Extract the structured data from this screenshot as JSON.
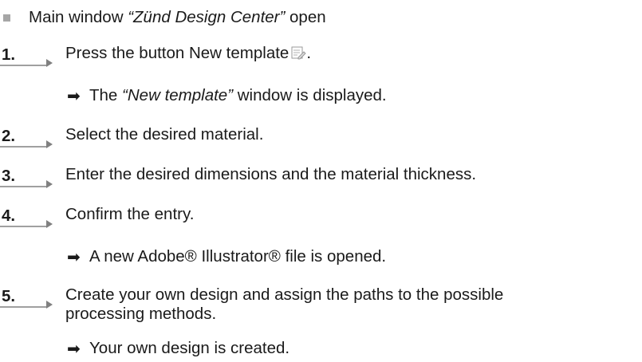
{
  "prerequisite": {
    "text_before": "Main window ",
    "window_name": "“Zünd Design Center”",
    "text_after": " open"
  },
  "steps": [
    {
      "number": "1.",
      "text": "Press the button New template",
      "icon": "new-template-icon",
      "text_after_icon": ".",
      "result": {
        "before": "The ",
        "emphasis": "“New template”",
        "after": " window is displayed."
      }
    },
    {
      "number": "2.",
      "text": "Select the desired material."
    },
    {
      "number": "3.",
      "text": "Enter the desired dimensions and the material thickness."
    },
    {
      "number": "4.",
      "text": "Confirm the entry.",
      "result": {
        "text": "A new Adobe® Illustrator® file is opened."
      }
    },
    {
      "number": "5.",
      "text_line1": "Create your own design and assign the paths to the possible",
      "text_line2": "processing methods.",
      "result": {
        "text": "Your own design is created."
      }
    }
  ],
  "result_arrow_glyph": "➡"
}
